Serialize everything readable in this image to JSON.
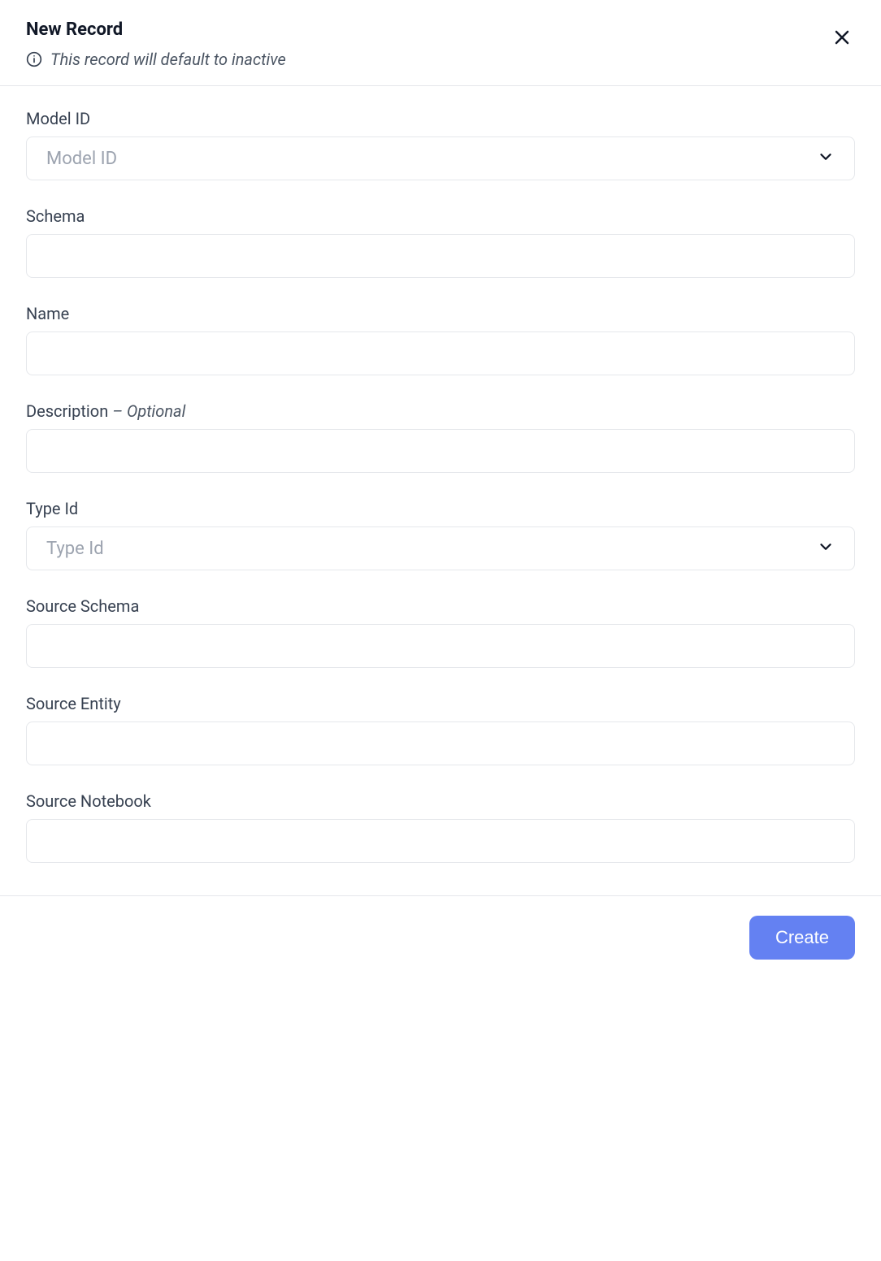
{
  "header": {
    "title": "New Record",
    "subtitle": "This record will default to inactive"
  },
  "fields": {
    "model_id": {
      "label": "Model ID",
      "placeholder": "Model ID"
    },
    "schema": {
      "label": "Schema",
      "value": ""
    },
    "name": {
      "label": "Name",
      "value": ""
    },
    "description": {
      "label": "Description",
      "optional_text": "– Optional",
      "value": ""
    },
    "type_id": {
      "label": "Type Id",
      "placeholder": "Type Id"
    },
    "source_schema": {
      "label": "Source Schema",
      "value": ""
    },
    "source_entity": {
      "label": "Source Entity",
      "value": ""
    },
    "source_notebook": {
      "label": "Source Notebook",
      "value": ""
    }
  },
  "footer": {
    "create_label": "Create"
  }
}
